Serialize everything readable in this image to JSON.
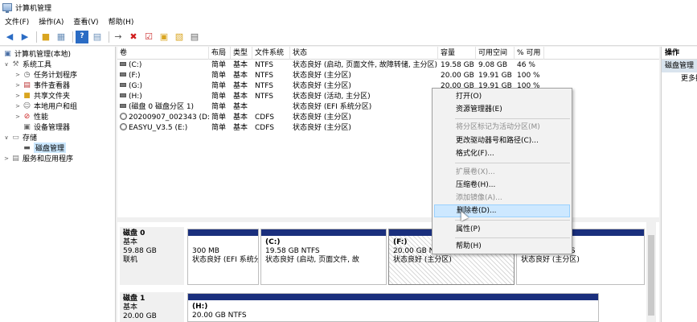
{
  "window": {
    "title": "计算机管理"
  },
  "menubar": {
    "items": [
      "文件(F)",
      "操作(A)",
      "查看(V)",
      "帮助(H)"
    ]
  },
  "toolbar": {
    "icons": [
      "back-arrow-icon",
      "forward-arrow-icon",
      "up-folder-icon",
      "console-tree-icon",
      "help-icon",
      "properties-icon",
      "connect-icon",
      "delete-icon",
      "check-icon",
      "search-icon",
      "export-icon",
      "view-icon"
    ]
  },
  "tree": {
    "root": "计算机管理(本地)",
    "system_tools": "系统工具",
    "task_scheduler": "任务计划程序",
    "event_viewer": "事件查看器",
    "shared_folders": "共享文件夹",
    "local_users": "本地用户和组",
    "performance": "性能",
    "device_manager": "设备管理器",
    "storage": "存储",
    "disk_management": "磁盘管理",
    "services": "服务和应用程序"
  },
  "volume_table": {
    "headers": [
      "卷",
      "布局",
      "类型",
      "文件系统",
      "状态",
      "容量",
      "可用空间",
      "% 可用"
    ],
    "rows": [
      [
        "(C:)",
        "简单",
        "基本",
        "NTFS",
        "状态良好 (启动, 页面文件, 故障转储, 主分区)",
        "19.58 GB",
        "9.08 GB",
        "46 %"
      ],
      [
        "(F:)",
        "简单",
        "基本",
        "NTFS",
        "状态良好 (主分区)",
        "20.00 GB",
        "19.91 GB",
        "100 %"
      ],
      [
        "(G:)",
        "简单",
        "基本",
        "NTFS",
        "状态良好 (主分区)",
        "20.00 GB",
        "19.91 GB",
        "100 %"
      ],
      [
        "(H:)",
        "简单",
        "基本",
        "NTFS",
        "状态良好 (活动, 主分区)",
        "",
        "",
        ""
      ],
      [
        "(磁盘 0 磁盘分区 1)",
        "简单",
        "基本",
        "",
        "状态良好 (EFI 系统分区)",
        "",
        "",
        ""
      ],
      [
        "20200907_002343 (D:)",
        "简单",
        "基本",
        "CDFS",
        "状态良好 (主分区)",
        "",
        "",
        ""
      ],
      [
        "EASYU_V3.5 (E:)",
        "简单",
        "基本",
        "CDFS",
        "状态良好 (主分区)",
        "",
        "",
        ""
      ]
    ]
  },
  "disks": [
    {
      "name": "磁盘 0",
      "type": "基本",
      "size": "59.88 GB",
      "status": "联机",
      "partitions": [
        {
          "name": "",
          "size": "300 MB",
          "status": "状态良好 (EFI 系统分"
        },
        {
          "name": "(C:)",
          "size": "19.58 GB NTFS",
          "status": "状态良好 (启动, 页面文件, 故"
        },
        {
          "name": "(F:)",
          "size": "20.00 GB NTFS",
          "status": "状态良好 (主分区)"
        },
        {
          "name": "",
          "size": "20.00 GB NTFS",
          "status": "状态良好 (主分区)"
        }
      ]
    },
    {
      "name": "磁盘 1",
      "type": "基本",
      "size": "20.00 GB",
      "partitions": [
        {
          "name": "(H:)",
          "size": "20.00 GB NTFS"
        }
      ]
    }
  ],
  "context_menu": {
    "items": [
      {
        "label": "打开(O)",
        "enabled": true
      },
      {
        "label": "资源管理器(E)",
        "enabled": true
      },
      {
        "label": "将分区标记为活动分区(M)",
        "enabled": false
      },
      {
        "label": "更改驱动器号和路径(C)...",
        "enabled": true
      },
      {
        "label": "格式化(F)...",
        "enabled": true
      },
      {
        "label": "扩展卷(X)...",
        "enabled": false
      },
      {
        "label": "压缩卷(H)...",
        "enabled": true
      },
      {
        "label": "添加镜像(A)...",
        "enabled": false
      },
      {
        "label": "删除卷(D)...",
        "enabled": true,
        "highlighted": true
      },
      {
        "label": "属性(P)",
        "enabled": true
      },
      {
        "label": "帮助(H)",
        "enabled": true
      }
    ]
  },
  "actions_pane": {
    "title": "操作",
    "section": "磁盘管理",
    "more": "更多操作"
  },
  "colors": {
    "partition_bar": "#1a2f7d",
    "menu_highlight": "#cde8ff",
    "selected_tree": "#cce8ff"
  }
}
